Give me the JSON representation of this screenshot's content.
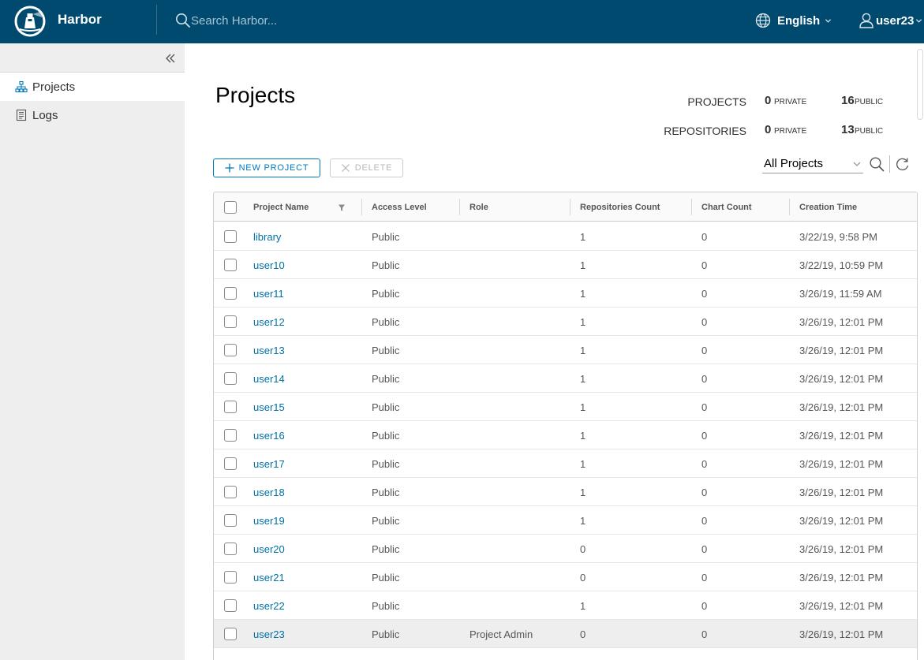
{
  "header": {
    "brand": "Harbor",
    "search_placeholder": "Search Harbor...",
    "language": "English",
    "username": "user23"
  },
  "sidebar": {
    "items": [
      {
        "label": "Projects",
        "icon": "projects-icon",
        "active": true
      },
      {
        "label": "Logs",
        "icon": "logs-icon",
        "active": false
      }
    ]
  },
  "main": {
    "title": "Projects",
    "stats": {
      "projects_label": "PROJECTS",
      "repositories_label": "REPOSITORIES",
      "projects_private": "0",
      "projects_public": "16",
      "repositories_private": "0",
      "repositories_public": "13",
      "private_label": "PRIVATE",
      "public_label": "PUBLIC"
    },
    "new_project_label": "NEW PROJECT",
    "delete_label": "DELETE",
    "filter_selected": "All Projects"
  },
  "grid": {
    "columns": [
      "Project Name",
      "Access Level",
      "Role",
      "Repositories Count",
      "Chart Count",
      "Creation Time"
    ],
    "rows": [
      {
        "name": "library",
        "access": "Public",
        "role": "",
        "repos": "1",
        "charts": "0",
        "created": "3/22/19, 9:58 PM"
      },
      {
        "name": "user10",
        "access": "Public",
        "role": "",
        "repos": "1",
        "charts": "0",
        "created": "3/22/19, 10:59 PM"
      },
      {
        "name": "user11",
        "access": "Public",
        "role": "",
        "repos": "1",
        "charts": "0",
        "created": "3/26/19, 11:59 AM"
      },
      {
        "name": "user12",
        "access": "Public",
        "role": "",
        "repos": "1",
        "charts": "0",
        "created": "3/26/19, 12:01 PM"
      },
      {
        "name": "user13",
        "access": "Public",
        "role": "",
        "repos": "1",
        "charts": "0",
        "created": "3/26/19, 12:01 PM"
      },
      {
        "name": "user14",
        "access": "Public",
        "role": "",
        "repos": "1",
        "charts": "0",
        "created": "3/26/19, 12:01 PM"
      },
      {
        "name": "user15",
        "access": "Public",
        "role": "",
        "repos": "1",
        "charts": "0",
        "created": "3/26/19, 12:01 PM"
      },
      {
        "name": "user16",
        "access": "Public",
        "role": "",
        "repos": "1",
        "charts": "0",
        "created": "3/26/19, 12:01 PM"
      },
      {
        "name": "user17",
        "access": "Public",
        "role": "",
        "repos": "1",
        "charts": "0",
        "created": "3/26/19, 12:01 PM"
      },
      {
        "name": "user18",
        "access": "Public",
        "role": "",
        "repos": "1",
        "charts": "0",
        "created": "3/26/19, 12:01 PM"
      },
      {
        "name": "user19",
        "access": "Public",
        "role": "",
        "repos": "1",
        "charts": "0",
        "created": "3/26/19, 12:01 PM"
      },
      {
        "name": "user20",
        "access": "Public",
        "role": "",
        "repos": "0",
        "charts": "0",
        "created": "3/26/19, 12:01 PM"
      },
      {
        "name": "user21",
        "access": "Public",
        "role": "",
        "repos": "0",
        "charts": "0",
        "created": "3/26/19, 12:01 PM"
      },
      {
        "name": "user22",
        "access": "Public",
        "role": "",
        "repos": "1",
        "charts": "0",
        "created": "3/26/19, 12:01 PM"
      },
      {
        "name": "user23",
        "access": "Public",
        "role": "Project Admin",
        "repos": "0",
        "charts": "0",
        "created": "3/26/19, 12:01 PM"
      }
    ]
  },
  "colors": {
    "header_bg": "#004a70",
    "sidebar_bg": "#eeeeee",
    "link": "#0072a3",
    "accent": "#0079b8"
  }
}
